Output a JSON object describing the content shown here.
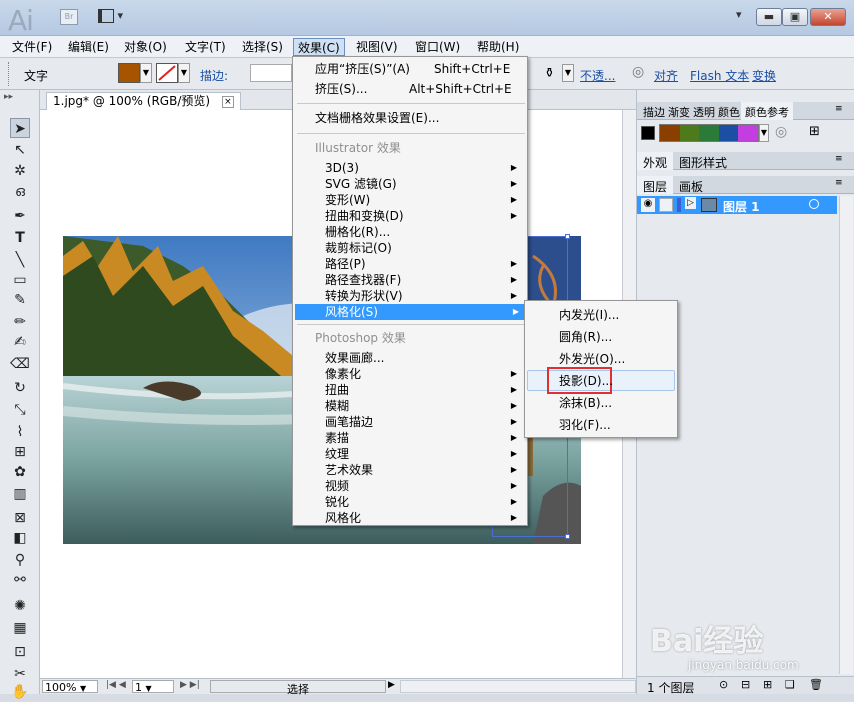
{
  "app": {
    "logo": "Ai",
    "bridge": "Br"
  },
  "menubar": [
    "文件(F)",
    "编辑(E)",
    "对象(O)",
    "文字(T)",
    "选择(S)",
    "效果(C)",
    "视图(V)",
    "窗口(W)",
    "帮助(H)"
  ],
  "control_bar": {
    "tool_label": "文字",
    "stroke_label": "描边:",
    "opacity": "不透...",
    "align": "对齐",
    "flash_text": "Flash 文本",
    "transform": "变换"
  },
  "document_tab": {
    "title": "1.jpg* @ 100% (RGB/预览)",
    "close": "×"
  },
  "effect_menu": {
    "apply_last": {
      "label": "应用“挤压(S)”(A)",
      "shortcut": "Shift+Ctrl+E"
    },
    "last_effect": {
      "label": "挤压(S)...",
      "shortcut": "Alt+Shift+Ctrl+E"
    },
    "raster_settings": "文档栅格效果设置(E)...",
    "illustrator_header": "Illustrator 效果",
    "illustrator_items": [
      "3D(3)",
      "SVG 滤镜(G)",
      "变形(W)",
      "扭曲和变换(D)",
      "栅格化(R)...",
      "裁剪标记(O)",
      "路径(P)",
      "路径查找器(F)",
      "转换为形状(V)",
      "风格化(S)"
    ],
    "photoshop_header": "Photoshop 效果",
    "photoshop_items": [
      "效果画廊...",
      "像素化",
      "扭曲",
      "模糊",
      "画笔描边",
      "素描",
      "纹理",
      "艺术效果",
      "视频",
      "锐化",
      "风格化"
    ]
  },
  "stylize_submenu": [
    "内发光(I)...",
    "圆角(R)...",
    "外发光(O)...",
    "投影(D)...",
    "涂抹(B)...",
    "羽化(F)..."
  ],
  "right_panel": {
    "tabs_top": [
      "描边",
      "渐变",
      "透明",
      "颜色",
      "颜色参考"
    ],
    "appearance_tabs": [
      "外观",
      "图形样式"
    ],
    "layer_tabs": [
      "图层",
      "画板"
    ],
    "layer_name": "图层 1",
    "layer_count": "1 个图层"
  },
  "status_bar": {
    "zoom": "100%",
    "artboard": "1",
    "tool": "选择"
  },
  "watermark": {
    "brand": "Bai经验",
    "url": "jingyan.baidu.com"
  },
  "colors": {
    "highlight": "#3399ff",
    "fill": "#a65400",
    "callout": "#e03030"
  }
}
